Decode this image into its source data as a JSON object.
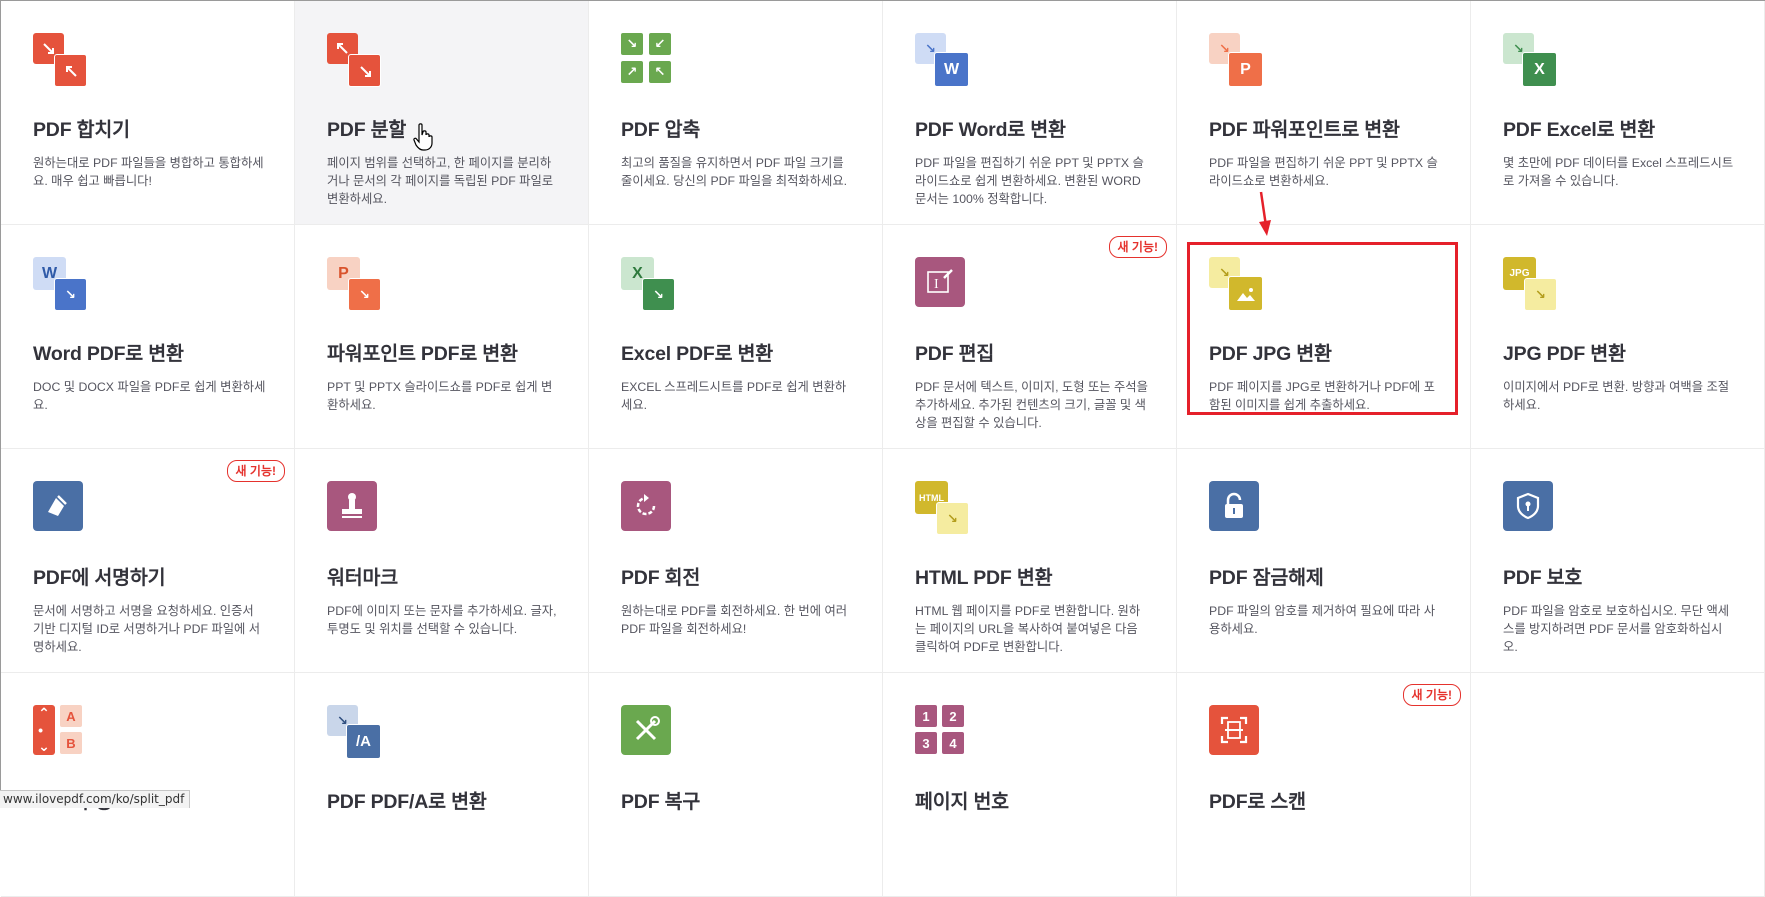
{
  "tools": [
    {
      "title": "PDF 합치기",
      "desc": "원하는대로 PDF 파일들을 병합하고 통합하세요. 매우 쉽고 빠릅니다!",
      "icon": "merge-icon",
      "color": "#e5533c"
    },
    {
      "title": "PDF 분할",
      "desc": "페이지 범위를 선택하고, 한 페이지를 분리하거나 문서의 각 페이지를 독립된 PDF 파일로 변환하세요.",
      "icon": "split-icon",
      "color": "#e5533c",
      "hovered": true
    },
    {
      "title": "PDF 압축",
      "desc": "최고의 품질을 유지하면서 PDF 파일 크기를 줄이세요. 당신의 PDF 파일을 최적화하세요.",
      "icon": "compress-icon",
      "color": "#6aa84f"
    },
    {
      "title": "PDF Word로 변환",
      "desc": "PDF 파일을 편집하기 쉬운 PPT 및 PPTX 슬라이드쇼로 쉽게 변환하세요. 변환된 WORD 문서는 100% 정확합니다.",
      "icon": "pdf-to-word-icon",
      "color": "#4a74c9"
    },
    {
      "title": "PDF 파워포인트로 변환",
      "desc": "PDF 파일을 편집하기 쉬운 PPT 및 PPTX 슬라이드쇼로 변환하세요.",
      "icon": "pdf-to-powerpoint-icon",
      "color": "#ef6f48"
    },
    {
      "title": "PDF Excel로 변환",
      "desc": "몇 초만에 PDF 데이터를 Excel 스프레드시트로 가져올 수 있습니다.",
      "icon": "pdf-to-excel-icon",
      "color": "#3f8f4f"
    },
    {
      "title": "Word PDF로 변환",
      "desc": "DOC 및 DOCX 파일을 PDF로 쉽게 변환하세요.",
      "icon": "word-to-pdf-icon",
      "color": "#4a74c9"
    },
    {
      "title": "파워포인트 PDF로 변환",
      "desc": "PPT 및 PPTX 슬라이드쇼를 PDF로 쉽게 변환하세요.",
      "icon": "powerpoint-to-pdf-icon",
      "color": "#ef6f48"
    },
    {
      "title": "Excel PDF로 변환",
      "desc": "EXCEL 스프레드시트를 PDF로 쉽게 변환하세요.",
      "icon": "excel-to-pdf-icon",
      "color": "#3f8f4f"
    },
    {
      "title": "PDF 편집",
      "desc": "PDF 문서에 텍스트, 이미지, 도형 또는 주석을 추가하세요. 추가된 컨텐츠의 크기, 글꼴 및 색상을 편집할 수 있습니다.",
      "icon": "edit-pdf-icon",
      "color": "#a8577e",
      "badge": "새 기능!"
    },
    {
      "title": "PDF JPG 변환",
      "desc": "PDF 페이지를 JPG로 변환하거나 PDF에 포함된 이미지를 쉽게 추출하세요.",
      "icon": "pdf-to-jpg-icon",
      "color": "#d1b82c"
    },
    {
      "title": "JPG PDF 변환",
      "desc": "이미지에서 PDF로 변환. 방향과 여백을 조절하세요.",
      "icon": "jpg-to-pdf-icon",
      "color": "#d1b82c"
    },
    {
      "title": "PDF에 서명하기",
      "desc": "문서에 서명하고 서명을 요청하세요. 인증서 기반 디지털 ID로 서명하거나 PDF 파일에 서명하세요.",
      "icon": "sign-icon",
      "color": "#4a6fa5",
      "badge": "새 기능!"
    },
    {
      "title": "워터마크",
      "desc": "PDF에 이미지 또는 문자를 추가하세요. 글자, 투명도 및 위치를 선택할 수 있습니다.",
      "icon": "watermark-icon",
      "color": "#a8577e"
    },
    {
      "title": "PDF 회전",
      "desc": "원하는대로 PDF를 회전하세요. 한 번에 여러 PDF 파일을 회전하세요!",
      "icon": "rotate-icon",
      "color": "#a8577e"
    },
    {
      "title": "HTML PDF 변환",
      "desc": "HTML 웹 페이지를 PDF로 변환합니다. 원하는 페이지의 URL을 복사하여 붙여넣은 다음 클릭하여 PDF로 변환합니다.",
      "icon": "html-to-pdf-icon",
      "color": "#d1b82c"
    },
    {
      "title": "PDF 잠금해제",
      "desc": "PDF 파일의 암호를 제거하여 필요에 따라 사용하세요.",
      "icon": "unlock-icon",
      "color": "#4a6fa5"
    },
    {
      "title": "PDF 보호",
      "desc": "PDF 파일을 암호로 보호하십시오. 무단 액세스를 방지하려면 PDF 문서를 암호화하십시오.",
      "icon": "protect-icon",
      "color": "#4a6fa5"
    },
    {
      "title": "PDF 구성",
      "desc": "",
      "icon": "organize-icon",
      "color": "#e5533c"
    },
    {
      "title": "PDF PDF/A로 변환",
      "desc": "",
      "icon": "pdf-to-pdfa-icon",
      "color": "#4a6fa5"
    },
    {
      "title": "PDF 복구",
      "desc": "",
      "icon": "repair-icon",
      "color": "#6aa84f"
    },
    {
      "title": "페이지 번호",
      "desc": "",
      "icon": "page-numbers-icon",
      "color": "#a8577e"
    },
    {
      "title": "PDF로 스캔",
      "desc": "",
      "icon": "scan-icon",
      "color": "#e5533c",
      "badge": "새 기능!"
    }
  ],
  "status_bar": {
    "url": "www.ilovepdf.com/ko/split_pdf"
  },
  "icon_text": {
    "word": "W",
    "powerpoint": "P",
    "excel": "X",
    "jpg": "JPG",
    "html": "HTML",
    "pdfa": "/A",
    "organize_a": "A",
    "organize_b": "B",
    "num1": "1",
    "num2": "2",
    "num3": "3",
    "num4": "4"
  },
  "annotations": {
    "highlight_color": "#e5202a",
    "highlighted_tool": "PDF JPG 변환"
  }
}
